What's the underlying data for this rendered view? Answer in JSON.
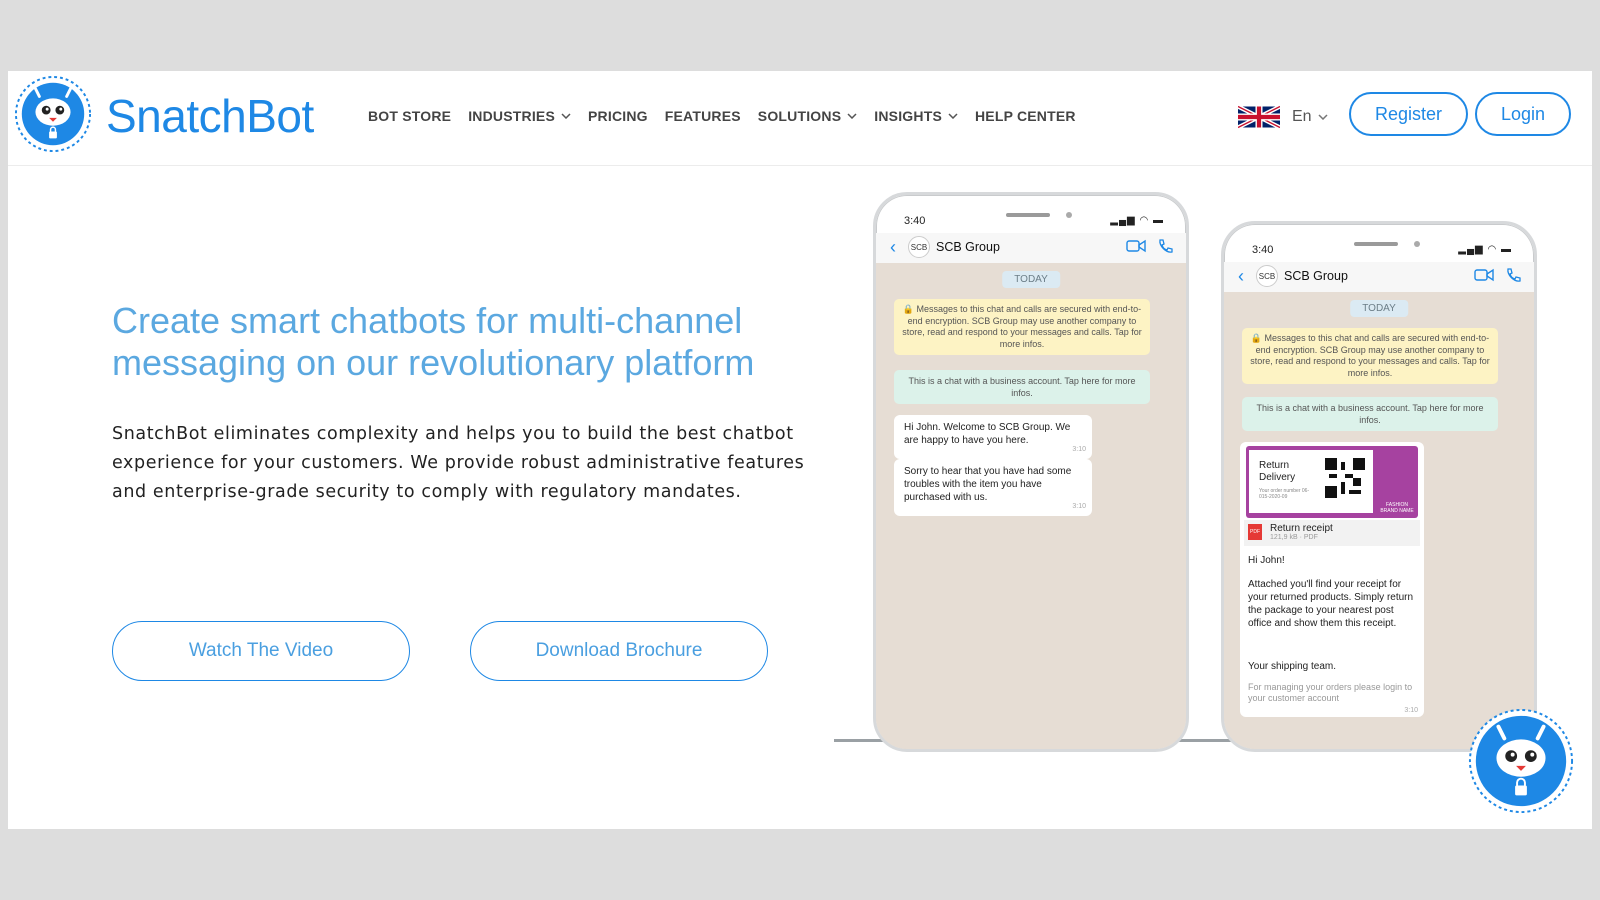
{
  "brand": {
    "name": "SnatchBot",
    "color": "#1e88e5"
  },
  "nav": {
    "items": [
      {
        "label": "BOT STORE",
        "dropdown": false
      },
      {
        "label": "INDUSTRIES",
        "dropdown": true
      },
      {
        "label": "PRICING",
        "dropdown": false
      },
      {
        "label": "FEATURES",
        "dropdown": false
      },
      {
        "label": "SOLUTIONS",
        "dropdown": true
      },
      {
        "label": "INSIGHTS",
        "dropdown": true
      },
      {
        "label": "HELP CENTER",
        "dropdown": false
      }
    ],
    "language": "En",
    "register": "Register",
    "login": "Login"
  },
  "hero": {
    "headline_line1": "Create smart chatbots for multi-channel",
    "headline_line2": "messaging on our revolutionary platform",
    "description": "SnatchBot eliminates complexity and helps you to build the best chatbot experience for your customers. We provide robust administrative features and enterprise-grade security to comply with regulatory mandates.",
    "cta_video": "Watch The Video",
    "cta_brochure": "Download Brochure"
  },
  "phone1": {
    "time": "3:40",
    "avatar": "SCB",
    "contact": "SCB Group",
    "today": "TODAY",
    "encryption": "Messages to this chat and calls are secured with end-to-end encryption. SCB Group may use another company to store, read and respond to your messages and calls. Tap for more infos.",
    "business": "This is a chat with a business account. Tap here for more infos.",
    "msg1": "Hi John. Welcome to SCB Group. We are happy to have you here.",
    "msg1_time": "3:10",
    "msg2": "Sorry to hear that you have had some troubles with the item you have purchased with us.",
    "msg2_time": "3:10"
  },
  "phone2": {
    "time": "3:40",
    "avatar": "SCB",
    "contact": "SCB Group",
    "today": "TODAY",
    "encryption": "Messages to this chat and calls are secured with end-to-end encryption. SCB Group may use another company to store, read and respond to your messages and calls. Tap for more infos.",
    "business": "This is a chat with a business account. Tap here for more infos.",
    "card_title": "Return Delivery",
    "card_small": "Your order number 06-015-2020-09",
    "card_brand": "FASHION BRAND NAME",
    "file_icon": "PDF",
    "file_name": "Return receipt",
    "file_meta": "121,9 kB · PDF",
    "greeting": "Hi John!",
    "body": "Attached you'll find your receipt for your returned products. Simply return the package to your nearest post office and show them this receipt.",
    "signoff": "Your shipping team.",
    "footer": "For managing your orders please login to your customer account",
    "time_stamp": "3:10"
  }
}
